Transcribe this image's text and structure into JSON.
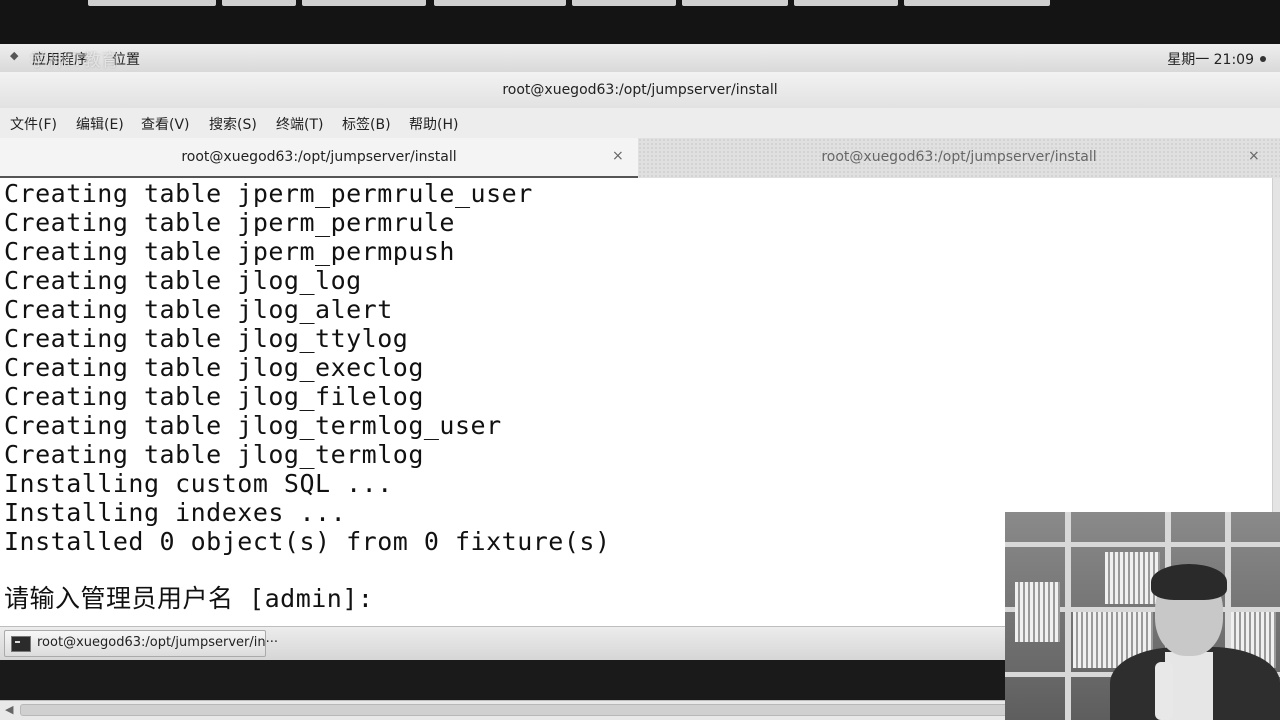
{
  "gnome_panel": {
    "applications": "应用程序",
    "places": "位置",
    "watermark": "学神IT教育",
    "clock": "星期一 21:09"
  },
  "window": {
    "title": "root@xuegod63:/opt/jumpserver/install"
  },
  "menubar": {
    "items": [
      "文件(F)",
      "编辑(E)",
      "查看(V)",
      "搜索(S)",
      "终端(T)",
      "标签(B)",
      "帮助(H)"
    ]
  },
  "tabs": [
    {
      "label": "root@xuegod63:/opt/jumpserver/install",
      "close": "×",
      "active": true
    },
    {
      "label": "root@xuegod63:/opt/jumpserver/install",
      "close": "×",
      "active": false
    }
  ],
  "terminal": {
    "lines": [
      "Creating table jperm_permrule_user",
      "Creating table jperm_permrule",
      "Creating table jperm_permpush",
      "Creating table jlog_log",
      "Creating table jlog_alert",
      "Creating table jlog_ttylog",
      "Creating table jlog_execlog",
      "Creating table jlog_filelog",
      "Creating table jlog_termlog_user",
      "Creating table jlog_termlog",
      "Installing custom SQL ...",
      "Installing indexes ...",
      "Installed 0 object(s) from 0 fixture(s)",
      "",
      "请输入管理员用户名 [admin]:"
    ]
  },
  "taskbar": {
    "item_label": "root@xuegod63:/opt/jumpserver/in···"
  },
  "icons": {
    "terminal_app": "terminal-icon",
    "webcam": "webcam-overlay"
  },
  "colors": {
    "terminal_bg": "#ffffff",
    "terminal_fg": "#111111",
    "panel_bg": "#e3e3e3"
  }
}
